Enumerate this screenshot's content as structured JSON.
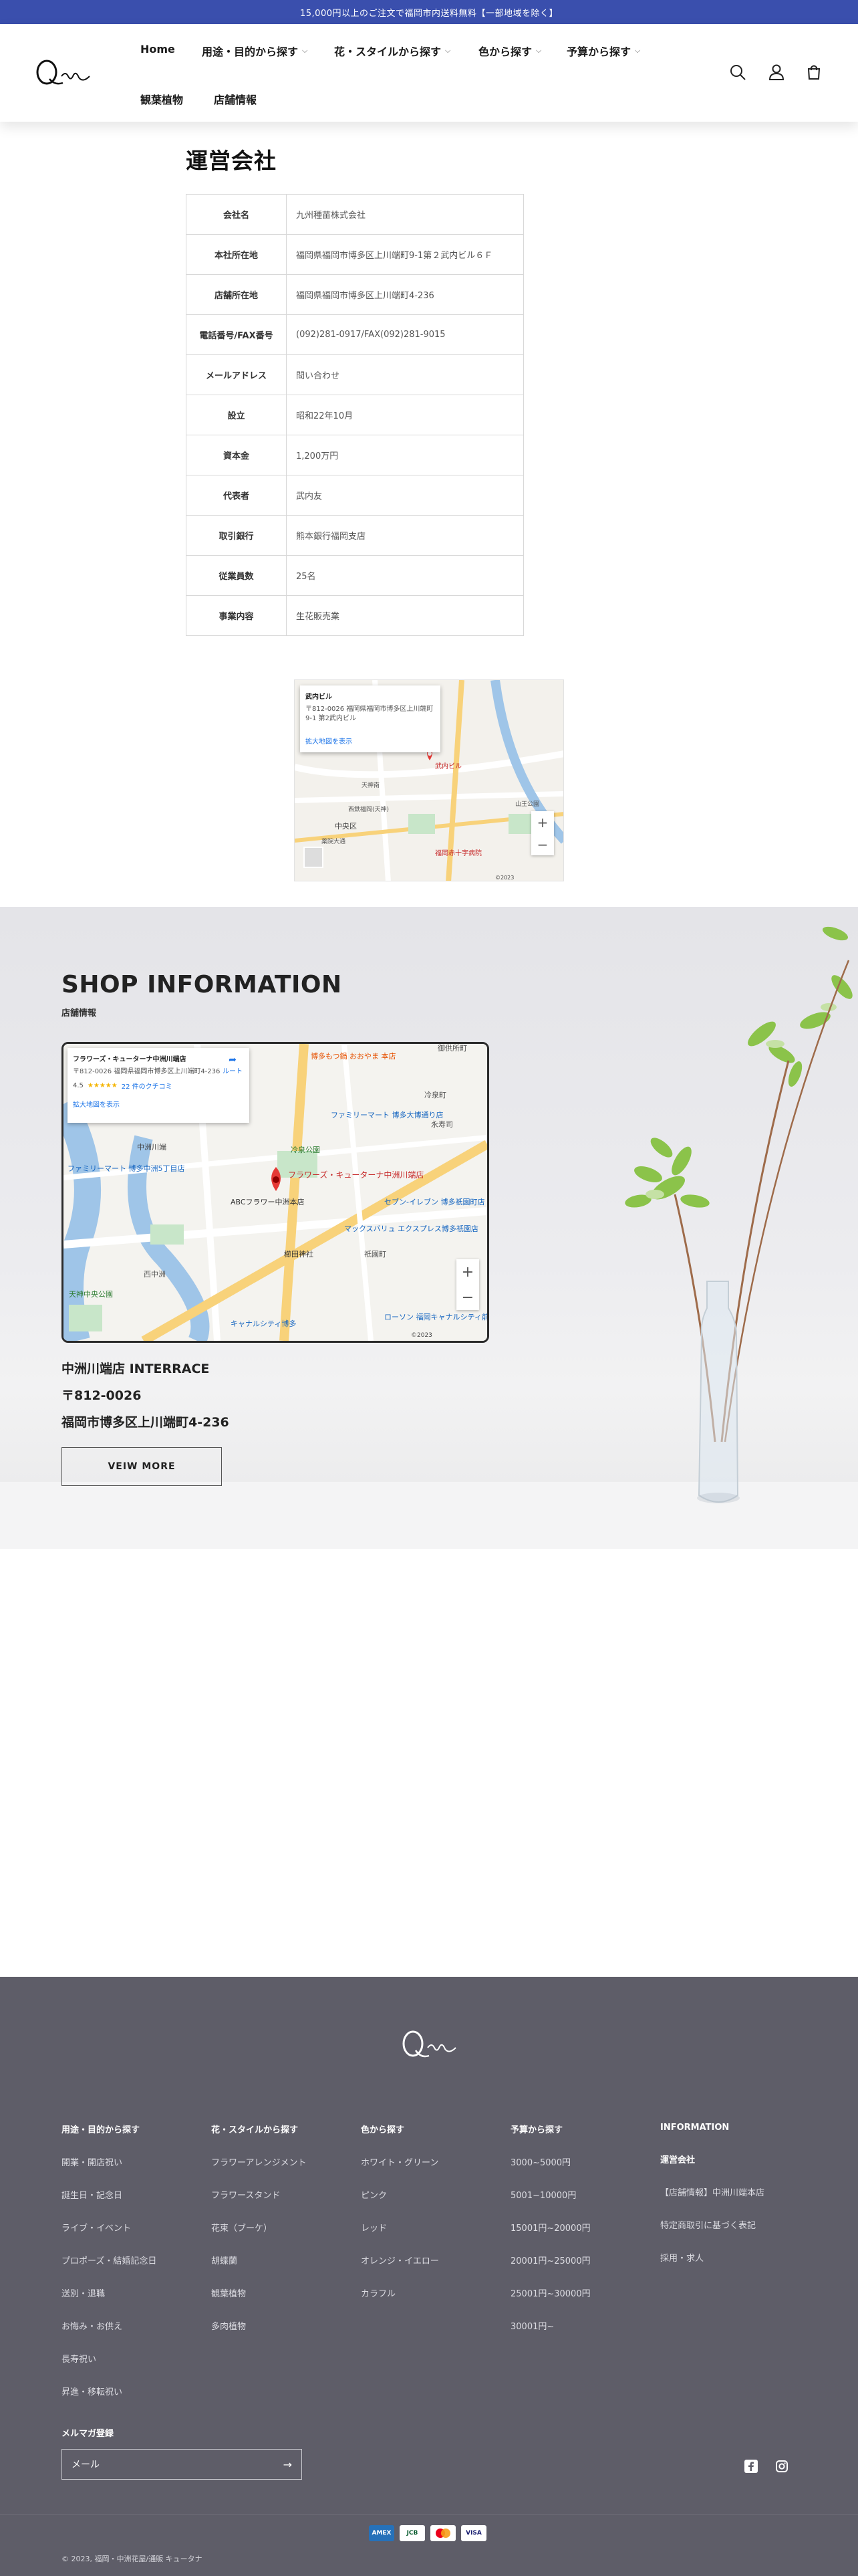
{
  "announcement": "15,000円以上のご注文で福岡市内送料無料【一部地域を除く】",
  "nav": {
    "items": [
      {
        "label": "Home",
        "has_menu": false
      },
      {
        "label": "用途・目的から探す",
        "has_menu": true
      },
      {
        "label": "花・スタイルから探す",
        "has_menu": true
      },
      {
        "label": "色から探す",
        "has_menu": true
      },
      {
        "label": "予算から探す",
        "has_menu": true
      },
      {
        "label": "観葉植物",
        "has_menu": false
      },
      {
        "label": "店舗情報",
        "has_menu": false
      }
    ],
    "icons": [
      "search-icon",
      "account-icon",
      "cart-icon"
    ]
  },
  "company": {
    "title": "運営会社",
    "rows": [
      {
        "key": "会社名",
        "value": "九州種苗株式会社"
      },
      {
        "key": "本社所在地",
        "value": "福岡県福岡市博多区上川端町9-1第２武内ビル６Ｆ"
      },
      {
        "key": "店舗所在地",
        "value": "福岡県福岡市博多区上川端町4-236"
      },
      {
        "key": "電話番号/FAX番号",
        "value": "(092)281-0917/FAX(092)281-9015"
      },
      {
        "key": "メールアドレス",
        "value": "問い合わせ"
      },
      {
        "key": "設立",
        "value": "昭和22年10月"
      },
      {
        "key": "資本金",
        "value": "1,200万円"
      },
      {
        "key": "代表者",
        "value": "武内友"
      },
      {
        "key": "取引銀行",
        "value": "熊本銀行福岡支店"
      },
      {
        "key": "従業員数",
        "value": "25名"
      },
      {
        "key": "事業内容",
        "value": "生花販売業"
      }
    ]
  },
  "map_small": {
    "card_title": "武内ビル",
    "card_address": "〒812-0026 福岡県福岡市博多区上川端町9-1 第2武内ビル",
    "card_link": "拡大地図を表示",
    "labels": [
      "天神南",
      "西鉄福岡(天神)",
      "中央区",
      "薬院大通",
      "福岡赤十字病院",
      "山王公園",
      "武内ビル"
    ],
    "zoom_in": "+",
    "zoom_out": "−",
    "footer_text": "©2023"
  },
  "shop": {
    "title": "SHOP INFORMATION",
    "subtitle": "店舗情報",
    "map": {
      "card_title": "フラワーズ・キューターナ中洲川端店",
      "card_address": "〒812-0026 福岡県福岡市博多区上川端町4-236",
      "rating": "4.5",
      "stars": "★★★★★",
      "reviews": "22 件のクチコミ",
      "card_link": "拡大地図を表示",
      "directions": "ルート",
      "labels": [
        "博多もつ鍋 おおやま 本店",
        "ファミリーマート 博多大博通り店",
        "冷泉公園",
        "中洲川端",
        "ファミリーマート 博多中洲5丁目店",
        "ABCフラワー中洲本店",
        "セブン-イレブン 博多祇園町店",
        "マックスバリュ エクスプレス博多祇園店",
        "櫛田神社",
        "祇園町",
        "西中洲",
        "天神中央公園",
        "ローソン 福岡キャナルシティ前店",
        "キャナルシティ博多",
        "フラワーズ・キューターナ中洲川端店",
        "御供所町",
        "冷泉町",
        "永寿司"
      ],
      "zoom_in": "+",
      "zoom_out": "−",
      "footer_text": "©2023"
    },
    "store_name": "中洲川端店 INTERRACE",
    "postal": "〒812-0026",
    "address": "福岡市博多区上川端町4-236",
    "view_more": "VEIW MORE"
  },
  "footer": {
    "columns": [
      {
        "heading": "用途・目的から探す",
        "links": [
          "開業・開店祝い",
          "誕生日・記念日",
          "ライブ・イベント",
          "プロポーズ・結婚記念日",
          "送別・退職",
          "お悔み・お供え",
          "長寿祝い",
          "昇進・移転祝い"
        ]
      },
      {
        "heading": "花・スタイルから探す",
        "links": [
          "フラワーアレンジメント",
          "フラワースタンド",
          "花束（ブーケ）",
          "胡蝶蘭",
          "観葉植物",
          "多肉植物"
        ]
      },
      {
        "heading": "色から探す",
        "links": [
          "ホワイト・グリーン",
          "ピンク",
          "レッド",
          "オレンジ・イエロー",
          "カラフル"
        ]
      },
      {
        "heading": "予算から探す",
        "links": [
          "3000~5000円",
          "5001~10000円",
          "15001円~20000円",
          "20001円~25000円",
          "25001円~30000円",
          "30001円~"
        ]
      },
      {
        "heading": "INFORMATION",
        "links": [
          "運営会社",
          "【店舗情報】中洲川端本店",
          "特定商取引に基づく表記",
          "採用・求人"
        ]
      }
    ],
    "newsletter_label": "メルマガ登録",
    "newsletter_placeholder": "メール",
    "payments": [
      "AMEX",
      "JCB",
      "MC",
      "VISA"
    ],
    "copyright": "© 2023, 福岡・中洲花屋/通販 キュータナ"
  }
}
